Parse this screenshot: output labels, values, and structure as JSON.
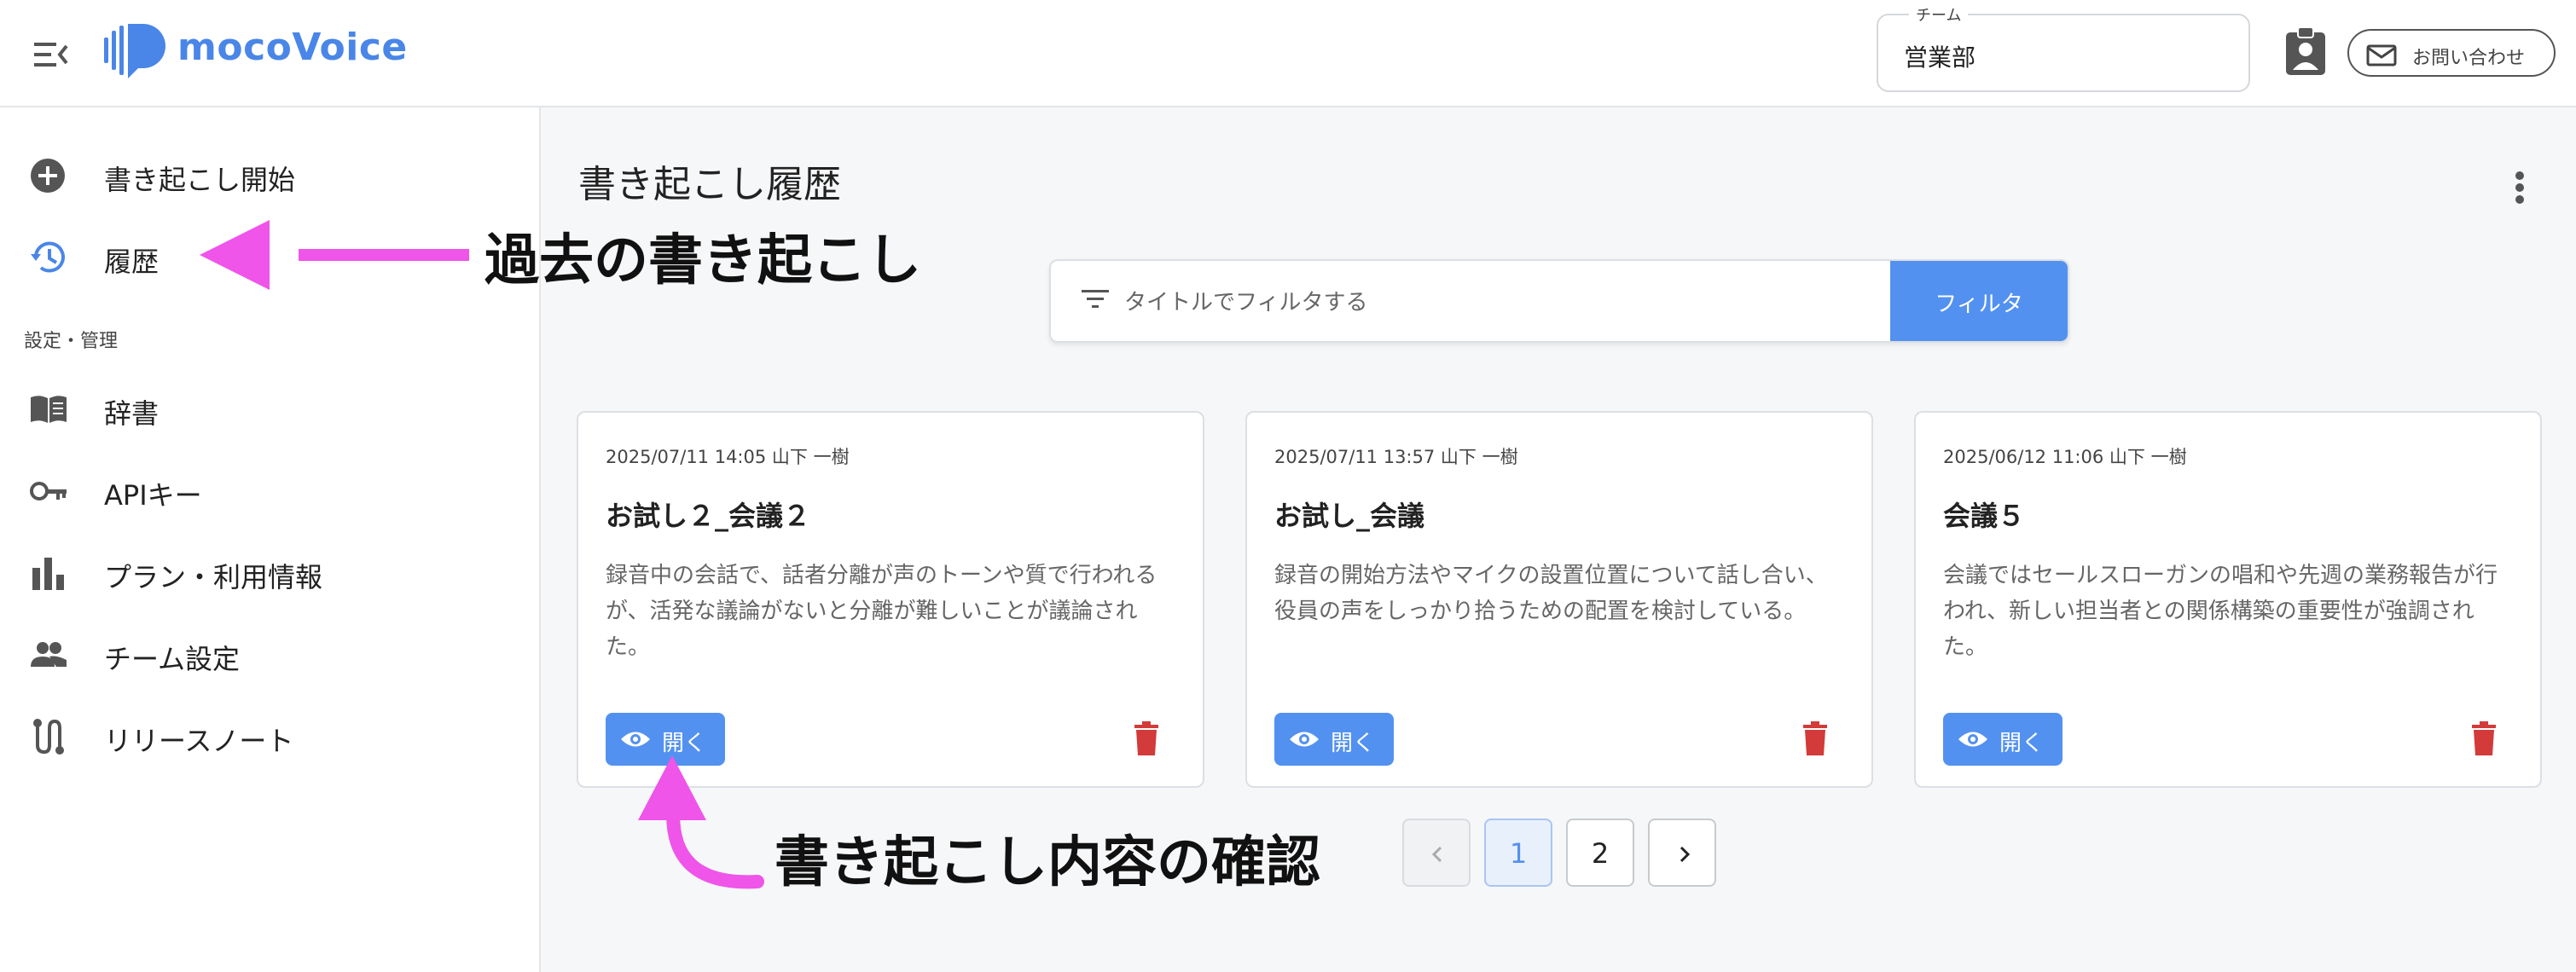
{
  "header": {
    "logo_text": "mocoVoice",
    "team_label": "チーム",
    "team_value": "営業部",
    "inquiry_label": "お問い合わせ"
  },
  "sidebar": {
    "items": [
      {
        "label": "書き起こし開始",
        "icon": "add-circle-icon"
      },
      {
        "label": "履歴",
        "icon": "history-icon"
      }
    ],
    "section_label": "設定・管理",
    "settings_items": [
      {
        "label": "辞書",
        "icon": "book-icon"
      },
      {
        "label": "APIキー",
        "icon": "key-icon"
      },
      {
        "label": "プラン・利用情報",
        "icon": "bar-chart-icon"
      },
      {
        "label": "チーム設定",
        "icon": "people-icon"
      },
      {
        "label": "リリースノート",
        "icon": "release-note-icon"
      }
    ]
  },
  "main": {
    "title": "書き起こし履歴",
    "filter": {
      "placeholder": "タイトルでフィルタする",
      "button_label": "フィルタ"
    },
    "cards": [
      {
        "meta": "2025/07/11 14:05 山下 一樹",
        "title": "お試し２_会議２",
        "summary": "録音中の会話で、話者分離が声のトーンや質で行われるが、活発な議論がないと分離が難しいことが議論された。",
        "open_label": "開く"
      },
      {
        "meta": "2025/07/11 13:57 山下 一樹",
        "title": "お試し_会議",
        "summary": "録音の開始方法やマイクの設置位置について話し合い、役員の声をしっかり拾うための配置を検討している。",
        "open_label": "開く"
      },
      {
        "meta": "2025/06/12 11:06 山下 一樹",
        "title": "会議５",
        "summary": "会議ではセールスローガンの唱和や先週の業務報告が行われ、新しい担当者との関係構築の重要性が強調された。",
        "open_label": "開く"
      }
    ],
    "pagination": {
      "pages": [
        "1",
        "2"
      ],
      "current_page": "1"
    }
  },
  "annotations": {
    "history_note": "過去の書き起こし",
    "open_note": "書き起こし内容の確認"
  },
  "colors": {
    "accent": "#5391f0",
    "logo": "#4a86e8",
    "delete": "#d33a3a",
    "annotation_arrow": "#ee55e8"
  }
}
